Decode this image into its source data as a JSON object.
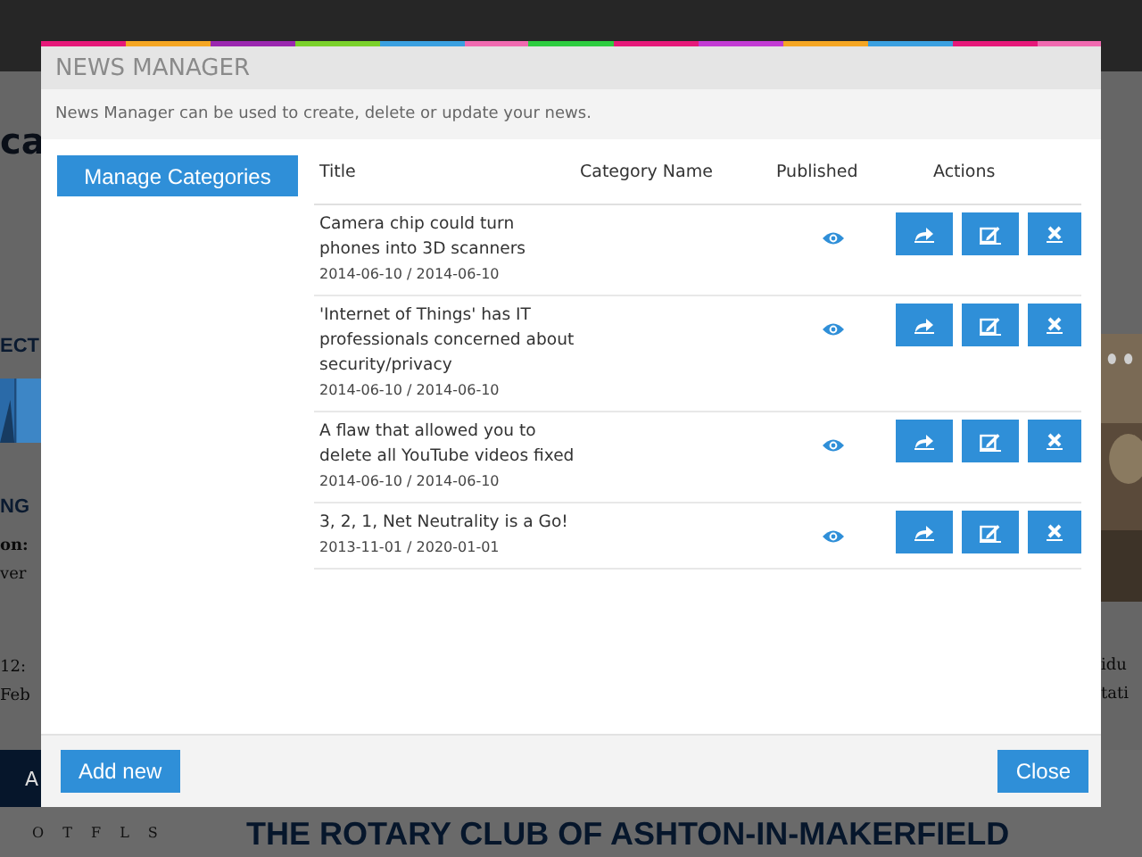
{
  "background_page": {
    "left_fragments": [
      "ca",
      "ECT",
      "NG",
      "on:",
      "ver",
      "12:",
      "Feb"
    ],
    "right_fragments": [
      "idu",
      "tati"
    ],
    "nav_fragment": "A",
    "calendar_fragment": "O T F L S",
    "heading": "THE ROTARY CLUB OF ASHTON-IN-MAKERFIELD"
  },
  "dialog": {
    "title": "NEWS MANAGER",
    "description": "News Manager can be used to create, delete or update your news.",
    "sidebar_button": "Manage Categories",
    "columns": [
      "Title",
      "Category Name",
      "Published",
      "Actions"
    ],
    "rows": [
      {
        "title": "Camera chip could turn phones into 3D scanners",
        "dates": "2014-06-10 / 2014-06-10",
        "published": true
      },
      {
        "title": "'Internet of Things' has IT professionals concerned about security/privacy",
        "dates": "2014-06-10 / 2014-06-10",
        "published": true
      },
      {
        "title": "A flaw that allowed you to delete all YouTube videos fixed",
        "dates": "2014-06-10 / 2014-06-10",
        "published": true
      },
      {
        "title": "3, 2, 1, Net Neutrality is a Go!",
        "dates": "2013-11-01 / 2020-01-01",
        "published": true
      }
    ],
    "footer": {
      "add_button": "Add new",
      "close_button": "Close"
    }
  }
}
